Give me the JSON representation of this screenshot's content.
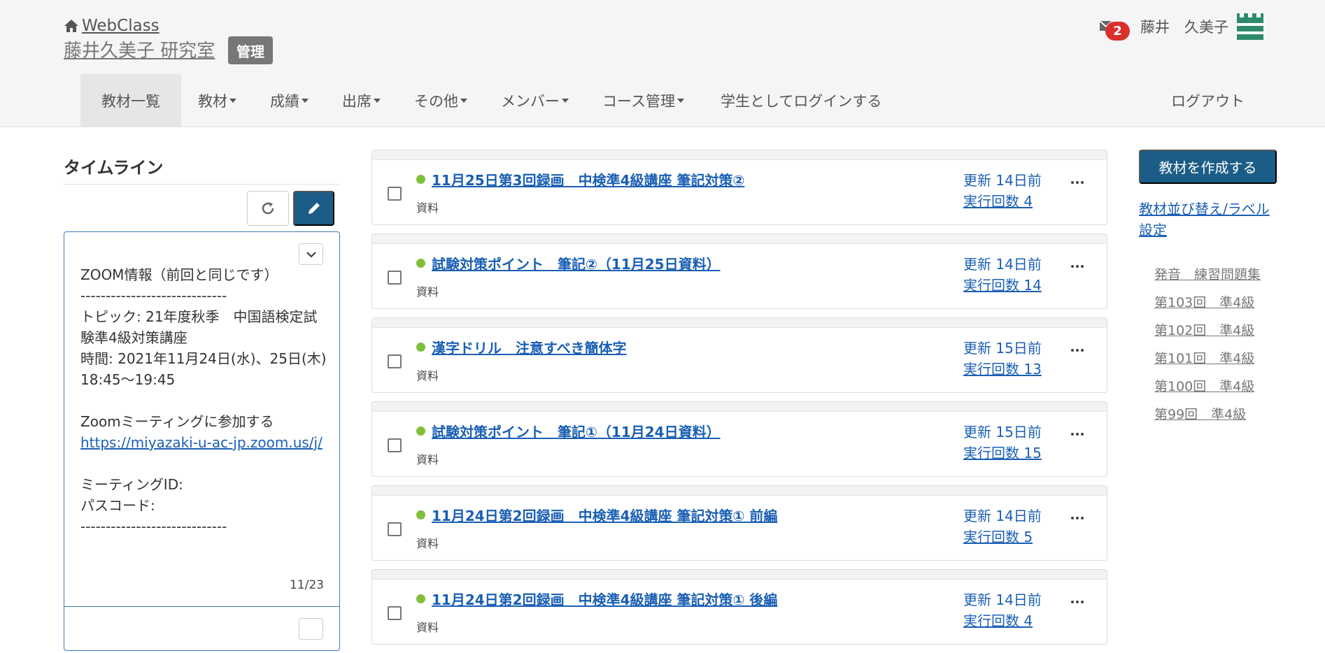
{
  "header": {
    "home_label": "WebClass",
    "course_title": "藤井久美子 研究室",
    "admin_badge": "管理",
    "mail_count": "2",
    "user_name": "藤井　久美子",
    "nav": [
      {
        "label": "教材一覧",
        "dropdown": false,
        "active": true
      },
      {
        "label": "教材",
        "dropdown": true
      },
      {
        "label": "成績",
        "dropdown": true
      },
      {
        "label": "出席",
        "dropdown": true
      },
      {
        "label": "その他",
        "dropdown": true
      },
      {
        "label": "メンバー",
        "dropdown": true
      },
      {
        "label": "コース管理",
        "dropdown": true
      },
      {
        "label": "学生としてログインする",
        "dropdown": false
      }
    ],
    "logout_label": "ログアウト"
  },
  "timeline": {
    "heading": "タイムライン",
    "post_text": "ZOOM情報（前回と同じです）\n-----------------------------\nトピック: 21年度秋季　中国語検定試験準4級対策講座\n時間: 2021年11月24日(水)、25日(木)　18:45～19:45\n\nZoomミーティングに参加する",
    "post_link": "https://miyazaki-u-ac-jp.zoom.us/j/",
    "post_text_after": "\n\nミーティングID:\nパスコード:\n-----------------------------",
    "post_date": "11/23"
  },
  "materials": [
    {
      "title": "11月25日第3回録画　中検準4級講座 筆記対策②",
      "type": "資料",
      "updated": "更新 14日前",
      "runs": "実行回数 4"
    },
    {
      "title": "試験対策ポイント　筆記②（11月25日資料）",
      "type": "資料",
      "updated": "更新 14日前",
      "runs": "実行回数 14"
    },
    {
      "title": "漢字ドリル　注意すべき簡体字",
      "type": "資料",
      "updated": "更新 15日前",
      "runs": "実行回数 13"
    },
    {
      "title": "試験対策ポイント　筆記①（11月24日資料）",
      "type": "資料",
      "updated": "更新 15日前",
      "runs": "実行回数 15"
    },
    {
      "title": "11月24日第2回録画　中検準4級講座 筆記対策① 前編",
      "type": "資料",
      "updated": "更新 14日前",
      "runs": "実行回数 5"
    },
    {
      "title": "11月24日第2回録画　中検準4級講座 筆記対策① 後編",
      "type": "資料",
      "updated": "更新 14日前",
      "runs": "実行回数 4"
    }
  ],
  "sidebar": {
    "create_button": "教材を作成する",
    "sort_link": "教材並び替え/ラベル設定",
    "labels": [
      "発音　練習問題集",
      "第103回　準4級",
      "第102回　準4級",
      "第101回　準4級",
      "第100回　準4級",
      "第99回　準4級"
    ]
  },
  "colors": {
    "primary": "#1b5d86",
    "link": "#1a5fb4",
    "badge_red": "#d9302c",
    "status_green": "#7fbf3a",
    "logo_green": "#2e8b6a"
  }
}
